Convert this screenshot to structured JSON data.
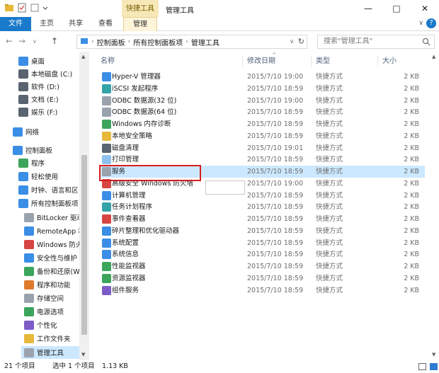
{
  "titlebar": {
    "context_tab": "快捷工具",
    "title": "管理工具",
    "minimize": "—",
    "maximize": "□",
    "close": "✕"
  },
  "ribbon": {
    "tabs": [
      "文件",
      "主页",
      "共享",
      "查看",
      "管理"
    ],
    "collapse": "∨",
    "help": "?"
  },
  "address": {
    "back": "←",
    "forward": "→",
    "recent": "∨",
    "up": "↑",
    "path": [
      "控制面板",
      "所有控制面板项",
      "管理工具"
    ],
    "separator": "›",
    "dropdown": "∨",
    "refresh": "↻",
    "search_placeholder": "搜索\"管理工具\""
  },
  "sidebar": {
    "items": [
      {
        "label": "桌面",
        "icon": "desktop-icon",
        "color": "#3a8ee6"
      },
      {
        "label": "本地磁盘 (C:)",
        "icon": "drive-icon",
        "color": "#5a6470"
      },
      {
        "label": "软件 (D:)",
        "icon": "drive-icon",
        "color": "#5a6470"
      },
      {
        "label": "文档 (E:)",
        "icon": "drive-icon",
        "color": "#5a6470"
      },
      {
        "label": "娱乐 (F:)",
        "icon": "drive-icon",
        "color": "#5a6470"
      },
      {
        "label": "网络",
        "icon": "network-icon",
        "color": "#3a8ee6"
      },
      {
        "label": "控制面板",
        "icon": "control-panel-icon",
        "color": "#3a8ee6"
      },
      {
        "label": "程序",
        "icon": "programs-icon",
        "color": "#3ca55c"
      },
      {
        "label": "轻松使用",
        "icon": "ease-of-access-icon",
        "color": "#3a8ee6"
      },
      {
        "label": "时钟、语言和区",
        "icon": "clock-icon",
        "color": "#3a8ee6"
      },
      {
        "label": "所有控制面板项",
        "icon": "control-panel-icon",
        "color": "#3a8ee6"
      },
      {
        "label": "BitLocker 驱动",
        "icon": "bitlocker-icon",
        "color": "#9aa3ad"
      },
      {
        "label": "RemoteApp 和",
        "icon": "remoteapp-icon",
        "color": "#3a8ee6"
      },
      {
        "label": "Windows 防火",
        "icon": "firewall-icon",
        "color": "#d64541"
      },
      {
        "label": "安全性与维护",
        "icon": "flag-icon",
        "color": "#3a8ee6"
      },
      {
        "label": "备份和还原(Wi",
        "icon": "backup-icon",
        "color": "#3ca55c"
      },
      {
        "label": "程序和功能",
        "icon": "programs-icon",
        "color": "#e07b2e"
      },
      {
        "label": "存储空间",
        "icon": "storage-icon",
        "color": "#9aa3ad"
      },
      {
        "label": "电源选项",
        "icon": "power-icon",
        "color": "#3ca55c"
      },
      {
        "label": "个性化",
        "icon": "personalize-icon",
        "color": "#7d5cc7"
      },
      {
        "label": "工作文件夹",
        "icon": "folder-icon",
        "color": "#e8b83a"
      },
      {
        "label": "管理工具",
        "icon": "admin-tools-icon",
        "color": "#9aa3ad",
        "selected": true
      }
    ]
  },
  "columns": {
    "name": "名称",
    "date": "修改日期",
    "type": "类型",
    "size": "大小",
    "sort_indicator": "^"
  },
  "files": [
    {
      "name": "Hyper-V 管理器",
      "date": "2015/7/10 19:00",
      "type": "快捷方式",
      "size": "2 KB",
      "color": "#3a8ee6"
    },
    {
      "name": "iSCSI 发起程序",
      "date": "2015/7/10 18:59",
      "type": "快捷方式",
      "size": "2 KB",
      "color": "#34a3a8"
    },
    {
      "name": "ODBC 数据源(32 位)",
      "date": "2015/7/10 19:00",
      "type": "快捷方式",
      "size": "2 KB",
      "color": "#9aa3ad"
    },
    {
      "name": "ODBC 数据源(64 位)",
      "date": "2015/7/10 18:59",
      "type": "快捷方式",
      "size": "2 KB",
      "color": "#9aa3ad"
    },
    {
      "name": "Windows 内存诊断",
      "date": "2015/7/10 18:59",
      "type": "快捷方式",
      "size": "2 KB",
      "color": "#3ca55c"
    },
    {
      "name": "本地安全策略",
      "date": "2015/7/10 18:59",
      "type": "快捷方式",
      "size": "2 KB",
      "color": "#e8b83a"
    },
    {
      "name": "磁盘清理",
      "date": "2015/7/10 19:01",
      "type": "快捷方式",
      "size": "2 KB",
      "color": "#5a6470"
    },
    {
      "name": "打印管理",
      "date": "2015/7/10 18:59",
      "type": "快捷方式",
      "size": "2 KB",
      "color": "#8fc1ef"
    },
    {
      "name": "服务",
      "date": "2015/7/10 18:59",
      "type": "快捷方式",
      "size": "2 KB",
      "color": "#9aa3ad",
      "selected": true
    },
    {
      "name": "高级安全 Windows 防火墙",
      "date": "2015/7/10 19:00",
      "type": "快捷方式",
      "size": "2 KB",
      "color": "#d64541"
    },
    {
      "name": "计算机管理",
      "date": "2015/7/10 18:59",
      "type": "快捷方式",
      "size": "2 KB",
      "color": "#3a8ee6"
    },
    {
      "name": "任务计划程序",
      "date": "2015/7/10 18:59",
      "type": "快捷方式",
      "size": "2 KB",
      "color": "#34a3a8"
    },
    {
      "name": "事件查看器",
      "date": "2015/7/10 18:59",
      "type": "快捷方式",
      "size": "2 KB",
      "color": "#d64541"
    },
    {
      "name": "碎片整理和优化驱动器",
      "date": "2015/7/10 18:59",
      "type": "快捷方式",
      "size": "2 KB",
      "color": "#3a8ee6"
    },
    {
      "name": "系统配置",
      "date": "2015/7/10 18:59",
      "type": "快捷方式",
      "size": "2 KB",
      "color": "#3a8ee6"
    },
    {
      "name": "系统信息",
      "date": "2015/7/10 18:59",
      "type": "快捷方式",
      "size": "2 KB",
      "color": "#3a8ee6"
    },
    {
      "name": "性能监视器",
      "date": "2015/7/10 18:59",
      "type": "快捷方式",
      "size": "2 KB",
      "color": "#3ca55c"
    },
    {
      "name": "资源监视器",
      "date": "2015/7/10 18:59",
      "type": "快捷方式",
      "size": "2 KB",
      "color": "#3ca55c"
    },
    {
      "name": "组件服务",
      "date": "2015/7/10 18:59",
      "type": "快捷方式",
      "size": "2 KB",
      "color": "#7d5cc7"
    }
  ],
  "status": {
    "item_count": "21 个项目",
    "selected": "选中 1 个项目",
    "selected_size": "1.13 KB"
  }
}
